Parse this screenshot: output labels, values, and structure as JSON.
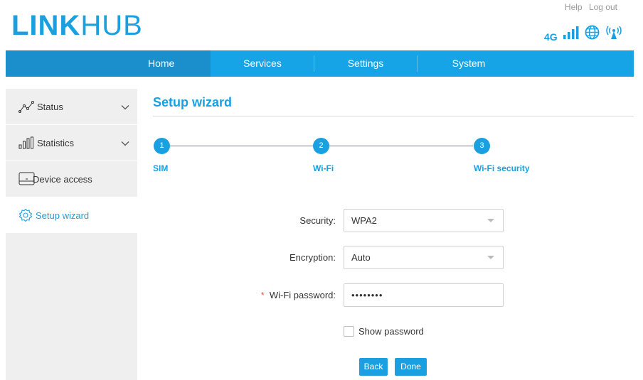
{
  "brand": {
    "logo_bold": "LINK",
    "logo_light": "HUB"
  },
  "top_links": {
    "help": "Help",
    "logout": "Log out"
  },
  "status": {
    "network_type": "4G",
    "icons": [
      "signal-strength-icon",
      "globe-icon",
      "wifi-broadcast-icon"
    ]
  },
  "nav": {
    "items": [
      "Home",
      "Services",
      "Settings",
      "System"
    ],
    "active": "Home"
  },
  "sidebar": {
    "items": [
      {
        "label": "Status",
        "icon": "line-chart-icon",
        "expandable": true
      },
      {
        "label": "Statistics",
        "icon": "bar-chart-icon",
        "expandable": true
      },
      {
        "label": "Device access",
        "icon": "device-icon",
        "expandable": false
      },
      {
        "label": "Setup wizard",
        "icon": "gear-icon",
        "expandable": false,
        "active": true
      }
    ]
  },
  "main": {
    "title": "Setup wizard",
    "steps": [
      {
        "number": "1",
        "label": "SIM"
      },
      {
        "number": "2",
        "label": "Wi-Fi"
      },
      {
        "number": "3",
        "label": "Wi-Fi security"
      }
    ],
    "form": {
      "security_label": "Security:",
      "security_value": "WPA2",
      "encryption_label": "Encryption:",
      "encryption_value": "Auto",
      "required_mark": "*",
      "password_label": "Wi-Fi password:",
      "password_value": "••••••••",
      "show_password_label": "Show password"
    },
    "buttons": {
      "back": "Back",
      "done": "Done"
    }
  },
  "colors": {
    "accent": "#1aa0e0",
    "nav_bg": "#17a4e6",
    "nav_active": "#1b8fcc",
    "sidebar_bg": "#efefef",
    "required": "#e05a4a"
  }
}
